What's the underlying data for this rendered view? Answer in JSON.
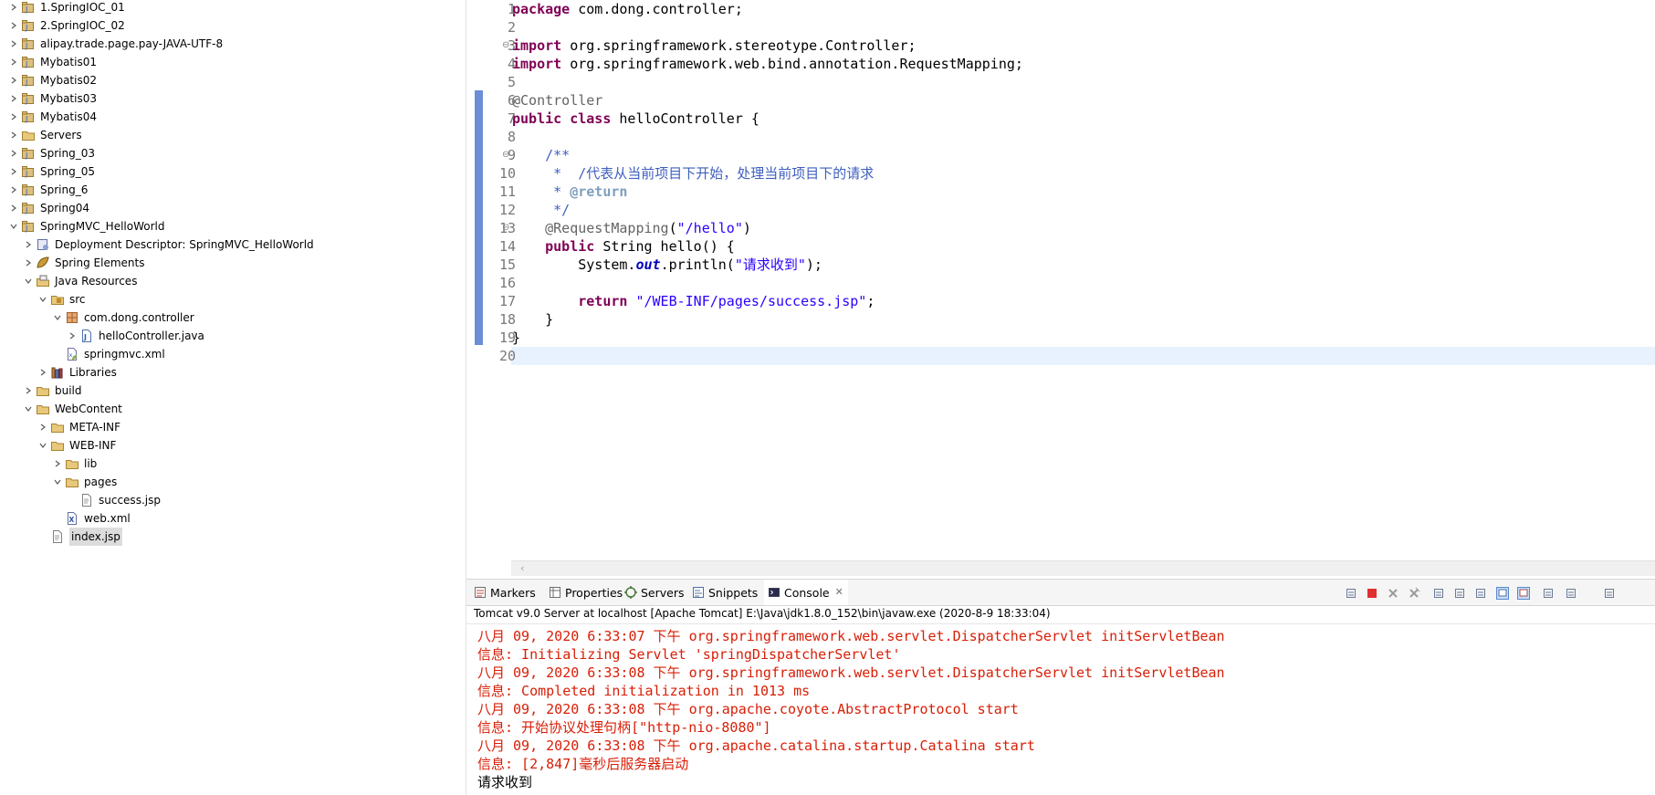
{
  "colors": {
    "error_text": "#d81e06",
    "keyword": "#7f0055",
    "string": "#2a00ff",
    "javadoc": "#3f5fbf",
    "annotation": "#646464",
    "change_marker": "#6b8ed6"
  },
  "project_tree": {
    "items": [
      {
        "label": "1.SpringIOC_01",
        "icon": "project-icon",
        "expanded": false
      },
      {
        "label": "2.SpringIOC_02",
        "icon": "project-icon",
        "expanded": false
      },
      {
        "label": "alipay.trade.page.pay-JAVA-UTF-8",
        "icon": "project-icon",
        "expanded": false
      },
      {
        "label": "Mybatis01",
        "icon": "project-icon",
        "expanded": false
      },
      {
        "label": "Mybatis02",
        "icon": "project-icon",
        "expanded": false
      },
      {
        "label": "Mybatis03",
        "icon": "project-icon",
        "expanded": false
      },
      {
        "label": "Mybatis04",
        "icon": "project-icon",
        "expanded": false
      },
      {
        "label": "Servers",
        "icon": "folder-icon",
        "expanded": false
      },
      {
        "label": "Spring_03",
        "icon": "project-icon",
        "expanded": false
      },
      {
        "label": "Spring_05",
        "icon": "project-icon",
        "expanded": false
      },
      {
        "label": "Spring_6",
        "icon": "project-icon",
        "expanded": false
      },
      {
        "label": "Spring04",
        "icon": "project-icon",
        "expanded": false
      },
      {
        "label": "SpringMVC_HelloWorld",
        "icon": "project-icon",
        "expanded": true
      },
      {
        "label": "Deployment Descriptor: SpringMVC_HelloWorld",
        "icon": "deployment-descriptor-icon",
        "expanded": false
      },
      {
        "label": "Spring Elements",
        "icon": "spring-leaf-icon",
        "expanded": false
      },
      {
        "label": "Java Resources",
        "icon": "java-resources-icon",
        "expanded": true
      },
      {
        "label": "src",
        "icon": "source-folder-icon",
        "expanded": true
      },
      {
        "label": "com.dong.controller",
        "icon": "package-icon",
        "expanded": true
      },
      {
        "label": "helloController.java",
        "icon": "java-file-icon",
        "expanded": false
      },
      {
        "label": "springmvc.xml",
        "icon": "spring-xml-icon",
        "expanded": null
      },
      {
        "label": "Libraries",
        "icon": "libraries-icon",
        "expanded": false
      },
      {
        "label": "build",
        "icon": "folder-icon",
        "expanded": false
      },
      {
        "label": "WebContent",
        "icon": "folder-icon",
        "expanded": true
      },
      {
        "label": "META-INF",
        "icon": "folder-icon",
        "expanded": false
      },
      {
        "label": "WEB-INF",
        "icon": "folder-icon",
        "expanded": true
      },
      {
        "label": "lib",
        "icon": "folder-icon",
        "expanded": false
      },
      {
        "label": "pages",
        "icon": "folder-icon",
        "expanded": true
      },
      {
        "label": "success.jsp",
        "icon": "jsp-file-icon",
        "expanded": null
      },
      {
        "label": "web.xml",
        "icon": "xml-file-icon",
        "expanded": null
      },
      {
        "label": "index.jsp",
        "icon": "jsp-file-icon",
        "expanded": null,
        "selected": true
      }
    ]
  },
  "editor": {
    "line_numbers": [
      "1",
      "2",
      "3",
      "4",
      "5",
      "6",
      "7",
      "8",
      "9",
      "10",
      "11",
      "12",
      "13",
      "14",
      "15",
      "16",
      "17",
      "18",
      "19",
      "20"
    ],
    "lines": [
      {
        "segments": [
          {
            "t": "package",
            "c": "kw"
          },
          {
            "t": " com.dong.controller;",
            "c": ""
          }
        ]
      },
      {
        "segments": []
      },
      {
        "segments": [
          {
            "t": "import",
            "c": "kw"
          },
          {
            "t": " org.springframework.stereotype.Controller;",
            "c": ""
          }
        ]
      },
      {
        "segments": [
          {
            "t": "import",
            "c": "kw"
          },
          {
            "t": " org.springframework.web.bind.annotation.RequestMapping;",
            "c": ""
          }
        ]
      },
      {
        "segments": []
      },
      {
        "segments": [
          {
            "t": "@Controller",
            "c": "ann"
          }
        ]
      },
      {
        "segments": [
          {
            "t": "public",
            "c": "kw"
          },
          {
            "t": " ",
            "c": ""
          },
          {
            "t": "class",
            "c": "kw"
          },
          {
            "t": " helloController {",
            "c": ""
          }
        ]
      },
      {
        "segments": []
      },
      {
        "segments": [
          {
            "t": "    /**",
            "c": "cmt"
          }
        ]
      },
      {
        "segments": [
          {
            "t": "     *  /代表从当前项目下开始，处理当前项目下的请求",
            "c": "cmt"
          }
        ]
      },
      {
        "segments": [
          {
            "t": "     * ",
            "c": "cmt"
          },
          {
            "t": "@return",
            "c": "tag"
          }
        ]
      },
      {
        "segments": [
          {
            "t": "     */",
            "c": "cmt"
          }
        ]
      },
      {
        "segments": [
          {
            "t": "    ",
            "c": ""
          },
          {
            "t": "@RequestMapping",
            "c": "ann"
          },
          {
            "t": "(",
            "c": ""
          },
          {
            "t": "\"/hello\"",
            "c": "str"
          },
          {
            "t": ")",
            "c": ""
          }
        ]
      },
      {
        "segments": [
          {
            "t": "    ",
            "c": ""
          },
          {
            "t": "public",
            "c": "kw"
          },
          {
            "t": " String hello() {",
            "c": ""
          }
        ]
      },
      {
        "segments": [
          {
            "t": "        System.",
            "c": ""
          },
          {
            "t": "out",
            "c": "fld"
          },
          {
            "t": ".println(",
            "c": ""
          },
          {
            "t": "\"请求收到\"",
            "c": "str"
          },
          {
            "t": ");",
            "c": ""
          }
        ]
      },
      {
        "segments": []
      },
      {
        "segments": [
          {
            "t": "        ",
            "c": ""
          },
          {
            "t": "return",
            "c": "kw"
          },
          {
            "t": " ",
            "c": ""
          },
          {
            "t": "\"/WEB-INF/pages/success.jsp\"",
            "c": "str"
          },
          {
            "t": ";",
            "c": ""
          }
        ]
      },
      {
        "segments": [
          {
            "t": "    }",
            "c": ""
          }
        ]
      },
      {
        "segments": [
          {
            "t": "}",
            "c": ""
          }
        ]
      },
      {
        "segments": []
      }
    ]
  },
  "views": {
    "tabs": [
      {
        "label": "Markers",
        "icon": "markers-icon"
      },
      {
        "label": "Properties",
        "icon": "properties-icon"
      },
      {
        "label": "Servers",
        "icon": "servers-icon"
      },
      {
        "label": "Snippets",
        "icon": "snippets-icon"
      },
      {
        "label": "Console",
        "icon": "console-icon",
        "active": true
      }
    ],
    "toolbar_icons": [
      "disconnect-icon",
      "terminate-icon",
      "remove-launch-icon",
      "remove-all-terminated-icon",
      "clear-console-icon",
      "scroll-lock-icon",
      "word-wrap-icon",
      "show-on-stdout-icon",
      "show-on-stderr-icon",
      "pin-console-icon",
      "display-selected-console-icon",
      "open-console-icon"
    ]
  },
  "console": {
    "process_label": "Tomcat v9.0 Server at localhost [Apache Tomcat] E:\\Java\\jdk1.8.0_152\\bin\\javaw.exe  (2020-8-9 18:33:04)",
    "lines": [
      {
        "text": "八月 09, 2020 6:33:07 下午 org.springframework.web.servlet.DispatcherServlet initServletBean",
        "stream": "stderr"
      },
      {
        "text": "信息: Initializing Servlet 'springDispatcherServlet'",
        "stream": "stderr"
      },
      {
        "text": "八月 09, 2020 6:33:08 下午 org.springframework.web.servlet.DispatcherServlet initServletBean",
        "stream": "stderr"
      },
      {
        "text": "信息: Completed initialization in 1013 ms",
        "stream": "stderr"
      },
      {
        "text": "八月 09, 2020 6:33:08 下午 org.apache.coyote.AbstractProtocol start",
        "stream": "stderr"
      },
      {
        "text": "信息: 开始协议处理句柄[\"http-nio-8080\"]",
        "stream": "stderr"
      },
      {
        "text": "八月 09, 2020 6:33:08 下午 org.apache.catalina.startup.Catalina start",
        "stream": "stderr"
      },
      {
        "text": "信息: [2,847]毫秒后服务器启动",
        "stream": "stderr"
      },
      {
        "text": "请求收到",
        "stream": "stdout"
      }
    ]
  }
}
